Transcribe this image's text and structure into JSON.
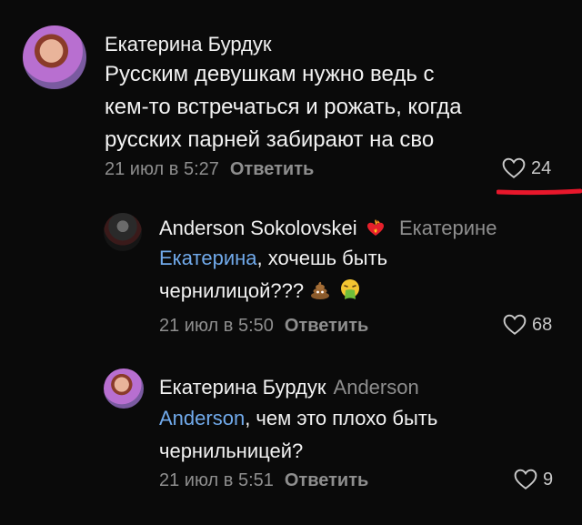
{
  "comments": [
    {
      "author": "Екатерина Бурдук",
      "reply_to": "",
      "mention": "",
      "text_lines": [
        "Русским девушкам нужно ведь с",
        "кем-то встречаться и рожать, когда",
        "русских парней забирают на сво"
      ],
      "date": "21 июл в 5:27",
      "reply_label": "Ответить",
      "likes": "24"
    },
    {
      "author": "Anderson Sokolovskei",
      "author_badge_icon": "heart-fire-emoji-icon",
      "reply_to": "Екатерине",
      "mention": "Екатерина",
      "text_rest_line1": ", хочешь быть",
      "text_line2": "чернилицой???",
      "emojis": [
        "poop-emoji-icon",
        "vomiting-face-emoji-icon"
      ],
      "date": "21 июл в 5:50",
      "reply_label": "Ответить",
      "likes": "68"
    },
    {
      "author": "Екатерина Бурдук",
      "reply_to": "Anderson",
      "mention": "Anderson",
      "text_rest_line1": ", чем это плохо быть",
      "text_line2": "чернильницей?",
      "date": "21 июл в 5:51",
      "reply_label": "Ответить",
      "likes": "9"
    }
  ],
  "colors": {
    "background": "#0a0a0a",
    "mention": "#71aaeb",
    "secondary": "#8e8e8e",
    "annotation_red": "#e8172b"
  }
}
